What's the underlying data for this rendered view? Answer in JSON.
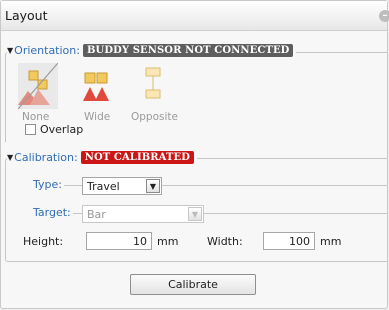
{
  "header": {
    "title": "Layout",
    "collapse_glyph": "–"
  },
  "orientation": {
    "label": "Orientation:",
    "badge": "BUDDY SENSOR NOT CONNECTED",
    "badge_color": "#5e5e5e",
    "options": [
      {
        "label": "None",
        "icon": "orientation-none-icon",
        "selected": true
      },
      {
        "label": "Wide",
        "icon": "orientation-wide-icon",
        "selected": false
      },
      {
        "label": "Opposite",
        "icon": "orientation-opposite-icon",
        "selected": false
      }
    ],
    "overlap": {
      "label": "Overlap",
      "checked": false
    }
  },
  "calibration": {
    "label": "Calibration:",
    "badge": "NOT CALIBRATED",
    "badge_color": "#cc1515",
    "type": {
      "label": "Type:",
      "value": "Travel"
    },
    "target": {
      "label": "Target:",
      "value": "Bar"
    },
    "height": {
      "label": "Height:",
      "value": "10",
      "unit": "mm"
    },
    "width": {
      "label": "Width:",
      "value": "100",
      "unit": "mm"
    },
    "calibrate_button": "Calibrate"
  },
  "colors": {
    "accent_label": "#2f6db6",
    "sensor_orange": "#f0b53a",
    "sensor_red": "#e04a3a"
  }
}
